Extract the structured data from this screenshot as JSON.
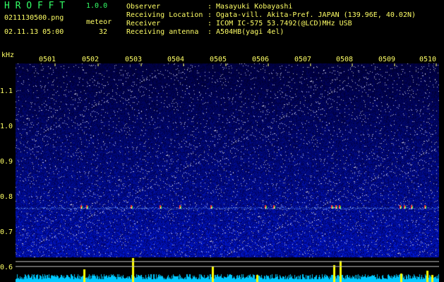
{
  "app": {
    "title": "H R O F F T",
    "version": "1.0.0"
  },
  "file": {
    "name": "0211130500.png",
    "datetime": "02.11.13 05:00"
  },
  "meteor": {
    "label": "meteor",
    "count": "32"
  },
  "info": [
    {
      "label": "Observer",
      "value": ": Masayuki Kobayashi"
    },
    {
      "label": "Receiving Location",
      "value": ": Ogata-vill. Akita-Pref. JAPAN (139.96E, 40.02N)"
    },
    {
      "label": "Receiver",
      "value": ": ICOM IC-575 53.7492(@LCD)MHz USB"
    },
    {
      "label": "Receiving antenna",
      "value": ": A504HB(yagi 4el)"
    }
  ],
  "axis": {
    "y_unit": "kHz",
    "y_ticks": [
      "1.1",
      "1.0",
      "0.9",
      "0.8",
      "0.7",
      "0.6"
    ],
    "x_ticks": [
      "0501",
      "0502",
      "0503",
      "0504",
      "0505",
      "0506",
      "0507",
      "0508",
      "0509",
      "0510"
    ]
  },
  "colors": {
    "label_text": "#ffff66",
    "title": "#33ff66",
    "noise_bg": "#0a0a3a",
    "spectrum": "#00ffff",
    "meteor_peaks": "#ffff00"
  }
}
